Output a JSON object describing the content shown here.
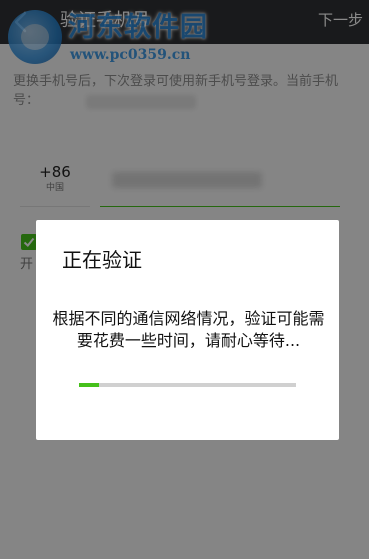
{
  "topbar": {
    "title": "验证手机号",
    "next_label": "下一步"
  },
  "watermark": {
    "name": "河东软件园",
    "url": "www.pc0359.cn"
  },
  "main": {
    "description": "更换手机号后，下次登录可使用新手机号登录。当前手机号：",
    "country_code": "+86",
    "country_name": "中国",
    "checkbox_label": "开"
  },
  "dialog": {
    "title": "正在验证",
    "message": "根据不同的通信网络情况，验证可能需要花费一些时间，请耐心等待...",
    "progress": 0.09
  },
  "colors": {
    "accent": "#45c01a",
    "topbar": "#2f3134"
  }
}
